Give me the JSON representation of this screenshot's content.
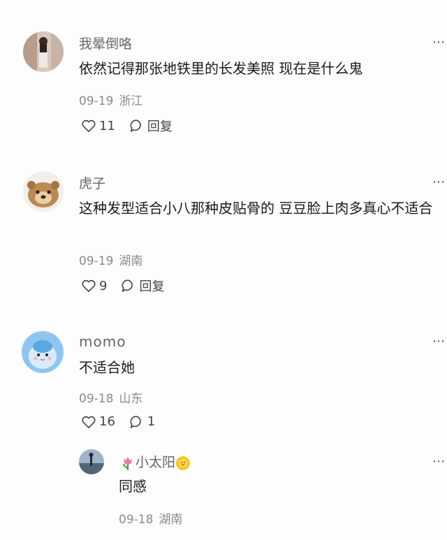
{
  "comments": [
    {
      "username": "我晕倒咯",
      "text": "依然记得那张地铁里的长发美照 现在是什么鬼",
      "date": "09-19",
      "location": "浙江",
      "likes": "11",
      "reply_label": "回复",
      "avatar_icon": "person-photo-avatar"
    },
    {
      "username": "虎子",
      "text": "这种发型适合小八那种皮贴骨的 豆豆脸上肉多真心不适合",
      "date": "09-19",
      "location": "湖南",
      "likes": "9",
      "reply_label": "回复",
      "avatar_icon": "lion-cub-avatar"
    },
    {
      "username": "momo",
      "text": "不适合她",
      "date": "09-18",
      "location": "山东",
      "likes": "16",
      "reply_count": "1",
      "avatar_icon": "blue-cartoon-avatar"
    }
  ],
  "reply": {
    "username": "小太阳",
    "text": "同感",
    "date": "09-18",
    "location": "湖南",
    "avatar_icon": "scenery-avatar",
    "name_prefix_icon": "tulip-emoji",
    "name_suffix_icon": "sun-emoji"
  },
  "more_label": "⋯"
}
